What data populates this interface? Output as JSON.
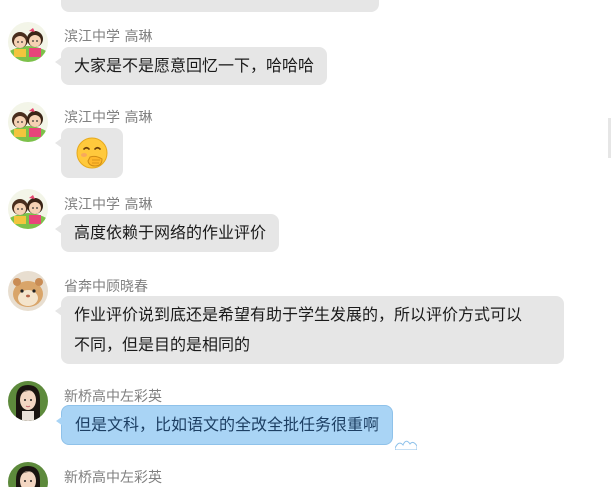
{
  "messages": [
    {
      "sender": "滨江中学 高琳",
      "text": "大家是不是愿意回忆一下，哈哈哈",
      "avatar": "cartoon-kids-avatar"
    },
    {
      "sender": "滨江中学 高琳",
      "text": "",
      "emoji": "🤭",
      "avatar": "cartoon-kids-avatar"
    },
    {
      "sender": "滨江中学 高琳",
      "text": "高度依赖于网络的作业评价",
      "avatar": "cartoon-kids-avatar"
    },
    {
      "sender": "省奔中顾晓春",
      "text_line1": "作业评价说到底还是希望有助于学生发展的，所以评价方式可以",
      "text_line2": "不同，但是目的是相同的",
      "avatar": "hamster-avatar"
    },
    {
      "sender": "新桥高中左彩英",
      "text": "但是文科，比如语文的全改全批任务很重啊",
      "avatar": "girl-portrait-avatar"
    },
    {
      "sender": "新桥高中左彩英",
      "avatar": "girl-portrait-avatar"
    }
  ],
  "colors": {
    "bubble_gray": "#e6e6e6",
    "bubble_blue": "#a9d4f5",
    "sender_text": "#808080"
  }
}
